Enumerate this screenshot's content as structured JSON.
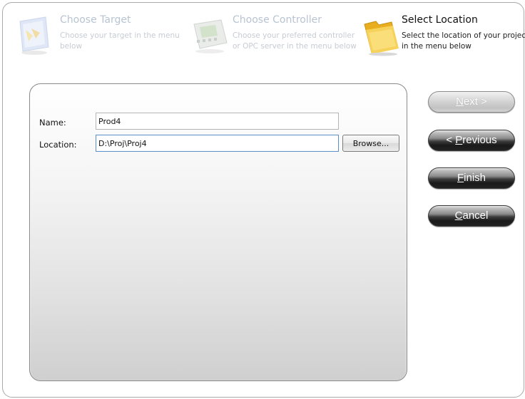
{
  "steps": [
    {
      "title": "Choose Target",
      "description": "Choose your target in the menu below",
      "state": "inactive",
      "icon": "target-folder-icon"
    },
    {
      "title": "Choose Controller",
      "description": "Choose your preferred controller or OPC server in the menu below",
      "state": "inactive",
      "icon": "controller-device-icon"
    },
    {
      "title": "Select Location",
      "description": "Select the location of your project in the menu below",
      "state": "active",
      "icon": "folder-icon"
    }
  ],
  "form": {
    "name_label": "Name:",
    "name_value": "Prod4",
    "location_label": "Location:",
    "location_value": "D:\\Proj\\Proj4",
    "browse_label": "Browse..."
  },
  "nav": {
    "next": {
      "accel": "N",
      "rest": "ext >",
      "enabled": false
    },
    "previous": {
      "prefix": "< ",
      "accel": "P",
      "rest": "revious",
      "enabled": true
    },
    "finish": {
      "accel": "F",
      "rest": "inish",
      "enabled": true
    },
    "cancel": {
      "accel": "C",
      "rest": "ancel",
      "enabled": true
    }
  },
  "colors": {
    "inactive_step_text": "#b8c4d2",
    "active_step_text": "#111111",
    "nav_button_dark": "#1a1a1a",
    "nav_button_disabled": "#cfcfcf",
    "folder_yellow": "#f2c23a"
  }
}
